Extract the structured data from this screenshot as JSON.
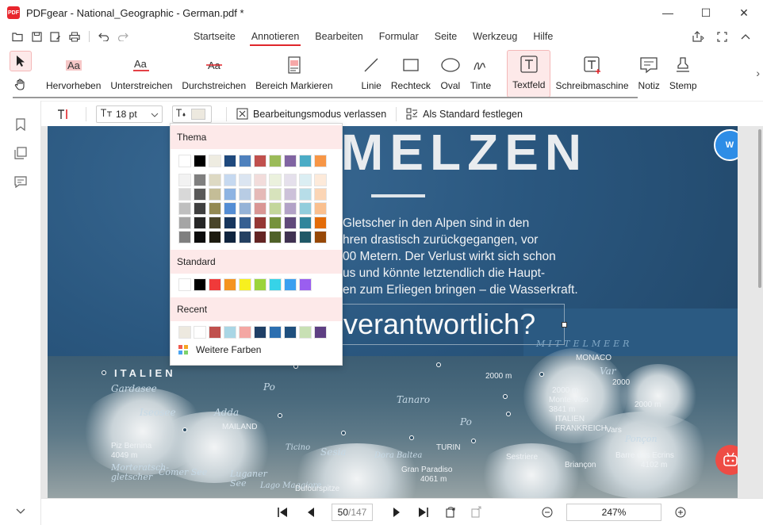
{
  "window": {
    "app_logo_text": "PDF",
    "title": "PDFgear - National_Geographic - German.pdf *",
    "controls": [
      "—",
      "☐",
      "✕"
    ]
  },
  "menu": {
    "tabs": [
      {
        "label": "Startseite",
        "active": false
      },
      {
        "label": "Annotieren",
        "active": true
      },
      {
        "label": "Bearbeiten",
        "active": false
      },
      {
        "label": "Formular",
        "active": false
      },
      {
        "label": "Seite",
        "active": false
      },
      {
        "label": "Werkzeug",
        "active": false
      },
      {
        "label": "Hilfe",
        "active": false
      }
    ]
  },
  "ribbon": {
    "tools": [
      {
        "label": "Hervorheben",
        "icon": "highlight-icon"
      },
      {
        "label": "Unterstreichen",
        "icon": "underline-icon"
      },
      {
        "label": "Durchstreichen",
        "icon": "strikethrough-icon"
      },
      {
        "label": "Bereich Markieren",
        "icon": "area-highlight-icon"
      },
      {
        "label": "Linie",
        "icon": "line-icon"
      },
      {
        "label": "Rechteck",
        "icon": "rectangle-icon"
      },
      {
        "label": "Oval",
        "icon": "oval-icon"
      },
      {
        "label": "Tinte",
        "icon": "ink-icon"
      },
      {
        "label": "Textfeld",
        "icon": "textbox-icon",
        "active": true
      },
      {
        "label": "Schreibmaschine",
        "icon": "typewriter-icon"
      },
      {
        "label": "Notiz",
        "icon": "note-icon"
      },
      {
        "label": "Stemp",
        "icon": "stamp-icon"
      }
    ]
  },
  "subbar": {
    "font_size": "18 pt",
    "exit_label": "Bearbeitungsmodus verlassen",
    "default_label": "Als Standard festlegen"
  },
  "color_dropdown": {
    "theme_label": "Thema",
    "standard_label": "Standard",
    "recent_label": "Recent",
    "more_label": "Weitere Farben",
    "theme_top": [
      "#ffffff",
      "#000000",
      "#eeece1",
      "#1f497d",
      "#4f81bd",
      "#c0504d",
      "#9bbb59",
      "#8064a2",
      "#4bacc6",
      "#f79646"
    ],
    "theme_shades": [
      [
        "#f2f2f2",
        "#7f7f7f",
        "#ddd9c3",
        "#c6d9f0",
        "#dbe5f1",
        "#f2dcdb",
        "#ebf1dd",
        "#e5e0ec",
        "#dbeef3",
        "#fdeada"
      ],
      [
        "#d8d8d8",
        "#595959",
        "#c4bd97",
        "#8db3e2",
        "#b8cce4",
        "#e5b9b7",
        "#d7e3bc",
        "#ccc1d9",
        "#b7dde8",
        "#fbd5b5"
      ],
      [
        "#bfbfbf",
        "#3f3f3f",
        "#938953",
        "#548dd4",
        "#95b3d7",
        "#d99694",
        "#c3d69b",
        "#b2a2c7",
        "#92cddc",
        "#fac08f"
      ],
      [
        "#a5a5a5",
        "#262626",
        "#494429",
        "#17365d",
        "#366092",
        "#953734",
        "#76923c",
        "#5f497a",
        "#31859b",
        "#e36c09"
      ],
      [
        "#7f7f7f",
        "#0c0c0c",
        "#1d1b10",
        "#0f243e",
        "#244061",
        "#632423",
        "#4f6128",
        "#3f3151",
        "#205867",
        "#974806"
      ]
    ],
    "standard": [
      "#ffffff",
      "#000000",
      "#f03a3a",
      "#f5931f",
      "#f7f01f",
      "#9bd43b",
      "#36d3e8",
      "#3b9ff0",
      "#9a5ef0"
    ],
    "recent": [
      "#ede9df",
      "#ffffff",
      "#c0504d",
      "#a9d6e5",
      "#f4a7a3",
      "#1f3f66",
      "#2d6fb0",
      "#1f4f7d",
      "#c8e0b4",
      "#5e3f83"
    ]
  },
  "document": {
    "heading": "MELZEN",
    "paragraph": [
      "Gletscher in den Alpen sind in den",
      "hren drastisch zurückgegangen, vor",
      "00 Metern. Der Verlust wirkt sich schon",
      "us und könnte letztendlich die Haupt-",
      "en zum Erliegen bringen – die Wasserkraft."
    ],
    "textbox_text": "verantwortlich?",
    "map_labels": {
      "italien": "ITALIEN",
      "mittelmeer": "MITTELMEER",
      "monaco": "MONACO",
      "var": "Var",
      "po_left": "Po",
      "tanaro": "Tanaro",
      "po_mid": "Po",
      "gardasee": "Gardasee",
      "iseosee": "Iseosee",
      "adda": "Adda",
      "mailand": "MAILAND",
      "piz_bernina": "Piz Bernina",
      "piz_bernina_h": "4049 m",
      "morteratsch": "Morteratsch-",
      "morteratsch2": "gletscher",
      "comer_see": "Comer See",
      "luganer_see": "Luganer",
      "luganer_see2": "See",
      "lago_maggiore": "Lago Maggiore",
      "ticino": "Ticino",
      "sesia": "Sesia",
      "dora_baltea": "Dora Baltea",
      "turin": "TURIN",
      "gran_paradiso": "Gran Paradiso",
      "gran_paradiso_h": "4061 m",
      "dufourspitze": "Dufourspitze",
      "monte_viso": "Monte Viso",
      "monte_viso_h": "3841 m",
      "italien_small": "ITALIEN",
      "frankreich": "FRANKREICH",
      "vars": "Vars",
      "ponc": "Ponçon",
      "sestriere": "Sestriere",
      "briancon": "Briançon",
      "barre": "Barre des Ecrins",
      "barre_h": "4102 m",
      "m2000a": "2000 m",
      "m2000b": "2000 m",
      "m2000c": "2000 m",
      "m2000d": "2000"
    }
  },
  "bottombar": {
    "current_page": "50",
    "total_pages": "/147",
    "zoom": "247%"
  }
}
